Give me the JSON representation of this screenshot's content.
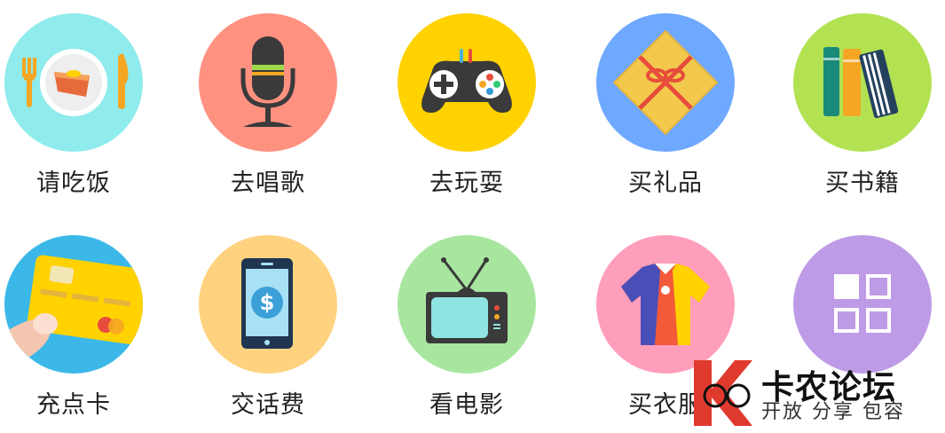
{
  "items": [
    {
      "label": "请吃饭",
      "icon": "meal-icon",
      "color": "#8FEBEC"
    },
    {
      "label": "去唱歌",
      "icon": "microphone-icon",
      "color": "#FF9180"
    },
    {
      "label": "去玩耍",
      "icon": "gamepad-icon",
      "color": "#FFD200"
    },
    {
      "label": "买礼品",
      "icon": "gift-icon",
      "color": "#6EA8FF"
    },
    {
      "label": "买书籍",
      "icon": "books-icon",
      "color": "#B2E252"
    },
    {
      "label": "充点卡",
      "icon": "credit-card-icon",
      "color": "#3BB8E8"
    },
    {
      "label": "交话费",
      "icon": "phone-bill-icon",
      "color": "#FFD27F"
    },
    {
      "label": "看电影",
      "icon": "tv-icon",
      "color": "#A8E6A0"
    },
    {
      "label": "买衣服",
      "icon": "shirt-icon",
      "color": "#FF9EBB"
    },
    {
      "label": "",
      "icon": "more-grid-icon",
      "color": "#BE9BE6"
    }
  ],
  "watermark": {
    "title": "卡农论坛",
    "subtitle": "开放 分享 包容"
  }
}
